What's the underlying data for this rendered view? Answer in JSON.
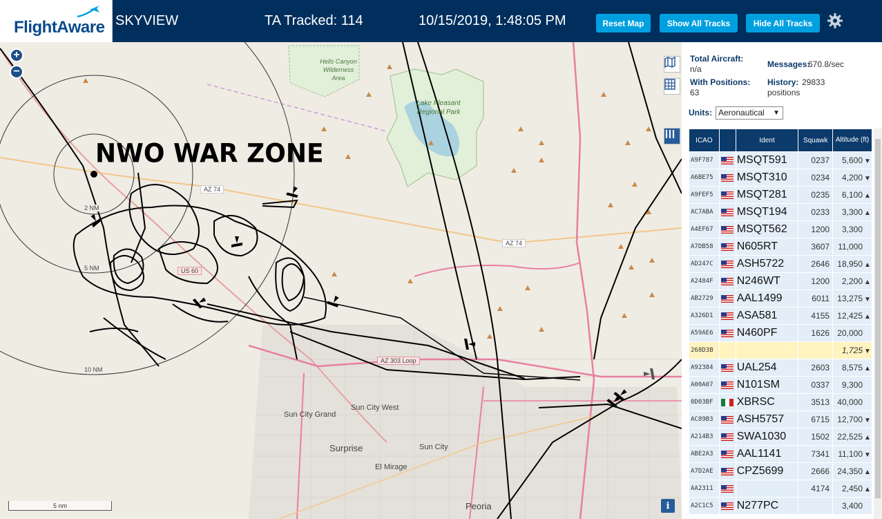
{
  "header": {
    "logo": "FlightAware",
    "app_name": "SKYVIEW",
    "tracked": "TA Tracked: 114",
    "datetime": "10/15/2019, 1:48:05 PM",
    "buttons": {
      "reset": "Reset Map",
      "show": "Show All Tracks",
      "hide": "Hide All Tracks"
    }
  },
  "map": {
    "overlay_text": "NWO WAR ZONE",
    "zoom_in": "+",
    "zoom_out": "−",
    "scale_label": "5 nm",
    "info": "i",
    "labels": {
      "hells_canyon": "Hells Canyon Wilderness Area",
      "lake_pleasant": "Lake Pleasant Regional Park",
      "az74a": "AZ 74",
      "az74b": "AZ 74",
      "az303": "AZ 303 Loop",
      "us60": "US 60",
      "sun_city_grand": "Sun City Grand",
      "sun_city_west": "Sun City West",
      "surprise": "Surprise",
      "sun_city": "Sun City",
      "el_mirage": "El Mirage",
      "peoria": "Peoria",
      "ring2": "2 NM",
      "ring5": "5 NM",
      "ring10": "10 NM"
    }
  },
  "stats": {
    "total_label": "Total Aircraft:",
    "total_value": "n/a",
    "positions_label": "With Positions:",
    "positions_value": "63",
    "messages_label": "Messages:",
    "messages_value": "670.8/sec",
    "history_label": "History:",
    "history_value": "29833 positions"
  },
  "units": {
    "label": "Units:",
    "selected": "Aeronautical"
  },
  "table": {
    "headers": {
      "icao": "ICAO",
      "ident": "Ident",
      "squawk": "Squawk",
      "altitude": "Altitude (ft)"
    },
    "rows": [
      {
        "icao": "A9F787",
        "flag": "us",
        "ident": "MSQT591",
        "squawk": "0237",
        "alt": "5,600",
        "trend": "▼"
      },
      {
        "icao": "A6BE75",
        "flag": "us",
        "ident": "MSQT310",
        "squawk": "0234",
        "alt": "4,200",
        "trend": "▼"
      },
      {
        "icao": "A9FEF5",
        "flag": "us",
        "ident": "MSQT281",
        "squawk": "0235",
        "alt": "6,100",
        "trend": "▲"
      },
      {
        "icao": "AC7ABA",
        "flag": "us",
        "ident": "MSQT194",
        "squawk": "0233",
        "alt": "3,300",
        "trend": "▲"
      },
      {
        "icao": "A4EF67",
        "flag": "us",
        "ident": "MSQT562",
        "squawk": "1200",
        "alt": "3,300",
        "trend": ""
      },
      {
        "icao": "A7DB58",
        "flag": "us",
        "ident": "N605RT",
        "squawk": "3607",
        "alt": "11,000",
        "trend": ""
      },
      {
        "icao": "AD247C",
        "flag": "us",
        "ident": "ASH5722",
        "squawk": "2646",
        "alt": "18,950",
        "trend": "▲"
      },
      {
        "icao": "A2484F",
        "flag": "us",
        "ident": "N246WT",
        "squawk": "1200",
        "alt": "2,200",
        "trend": "▲"
      },
      {
        "icao": "AB2729",
        "flag": "us",
        "ident": "AAL1499",
        "squawk": "6011",
        "alt": "13,275",
        "trend": "▼"
      },
      {
        "icao": "A326D1",
        "flag": "us",
        "ident": "ASA581",
        "squawk": "4155",
        "alt": "12,425",
        "trend": "▲"
      },
      {
        "icao": "A59AE6",
        "flag": "us",
        "ident": "N460PF",
        "squawk": "1626",
        "alt": "20,000",
        "trend": ""
      },
      {
        "icao": "268D3B",
        "flag": "",
        "ident": "",
        "squawk": "",
        "alt": "1,725",
        "trend": "▼",
        "highlight": true
      },
      {
        "icao": "A92384",
        "flag": "us",
        "ident": "UAL254",
        "squawk": "2603",
        "alt": "8,575",
        "trend": "▲"
      },
      {
        "icao": "A00A07",
        "flag": "us",
        "ident": "N101SM",
        "squawk": "0337",
        "alt": "9,300",
        "trend": ""
      },
      {
        "icao": "0D03BF",
        "flag": "mx",
        "ident": "XBRSC",
        "squawk": "3513",
        "alt": "40,000",
        "trend": ""
      },
      {
        "icao": "AC89B3",
        "flag": "us",
        "ident": "ASH5757",
        "squawk": "6715",
        "alt": "12,700",
        "trend": "▼"
      },
      {
        "icao": "A214B3",
        "flag": "us",
        "ident": "SWA1030",
        "squawk": "1502",
        "alt": "22,525",
        "trend": "▲"
      },
      {
        "icao": "ABE2A3",
        "flag": "us",
        "ident": "AAL1141",
        "squawk": "7341",
        "alt": "11,100",
        "trend": "▼"
      },
      {
        "icao": "A7D2AE",
        "flag": "us",
        "ident": "CPZ5699",
        "squawk": "2666",
        "alt": "24,350",
        "trend": "▲"
      },
      {
        "icao": "AA2311",
        "flag": "us",
        "ident": "",
        "squawk": "4174",
        "alt": "2,450",
        "trend": "▲"
      },
      {
        "icao": "A2C1C5",
        "flag": "us",
        "ident": "N277PC",
        "squawk": "",
        "alt": "3,400",
        "trend": ""
      }
    ]
  }
}
